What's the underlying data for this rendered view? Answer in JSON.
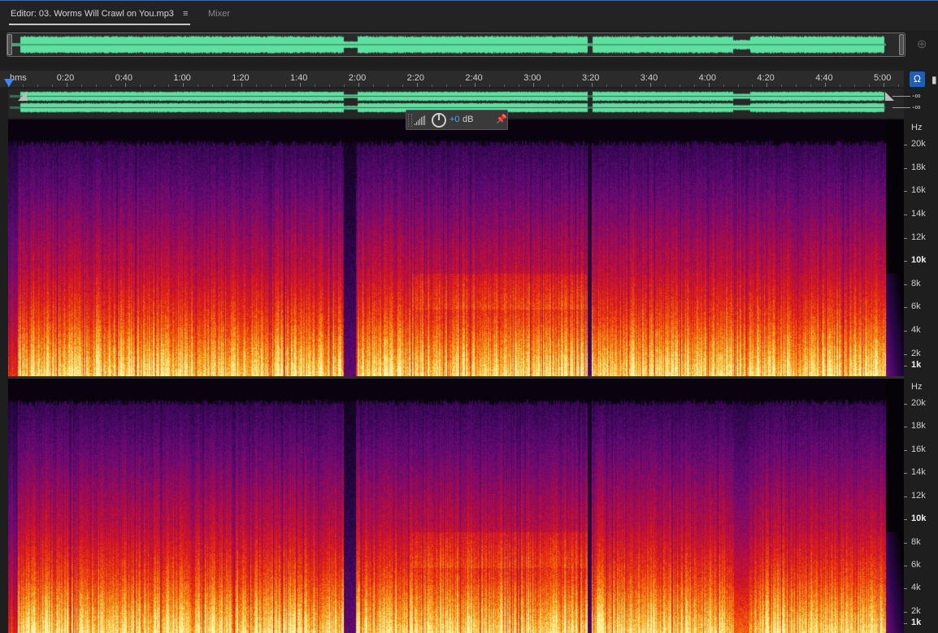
{
  "tabs": {
    "editor_label": "Editor: 03. Worms Will Crawl on You.mp3",
    "menu_icon": "≡",
    "mixer_label": "Mixer"
  },
  "ruler": {
    "unit_label": "hms",
    "ticks": [
      "0:20",
      "0:40",
      "1:00",
      "1:20",
      "1:40",
      "2:00",
      "2:20",
      "2:40",
      "3:00",
      "3:20",
      "3:40",
      "4:00",
      "4:20",
      "4:40",
      "5:00"
    ]
  },
  "levels": {
    "channel_1": "-∞",
    "channel_2": "-∞"
  },
  "hud": {
    "value": "+0",
    "unit": "dB"
  },
  "spectral": {
    "unit_label": "Hz",
    "labels": [
      "20k",
      "18k",
      "16k",
      "14k",
      "12k",
      "10k",
      "8k",
      "6k",
      "4k",
      "2k",
      "1k"
    ]
  },
  "icons": {
    "zoom": "zoom-icon",
    "snap": "headphones-snap-icon",
    "marker": "marker-icon",
    "pin": "pin-icon",
    "knob": "volume-knob-icon",
    "meter": "level-meter-icon"
  },
  "colors": {
    "waveform": "#5ee0a0",
    "accent": "#3a86ff",
    "hud_value": "#4aa3ff"
  }
}
